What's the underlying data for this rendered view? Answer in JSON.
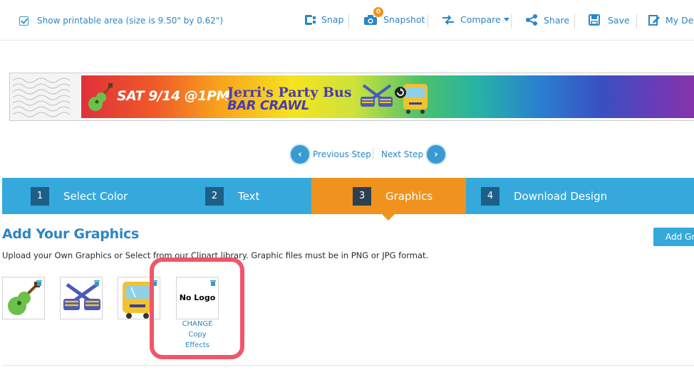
{
  "toolbar": {
    "printable_label": "Show printable area (size is 9.50\" by 0.62\")",
    "snap_label": "Snap",
    "snapshot_label": "Snapshot",
    "snapshot_badge": "0",
    "compare_label": "Compare",
    "share_label": "Share",
    "save_label": "Save",
    "mydesigns_label": "My Des"
  },
  "preview": {
    "date_text": "SAT 9/14 @1PM",
    "line1": "Jerri's Party Bus",
    "line2": "BAR CRAWL"
  },
  "step_nav": {
    "previous_label": "Previous Step",
    "next_label": "Next Step"
  },
  "steps": [
    {
      "num": "1",
      "label": "Select Color"
    },
    {
      "num": "2",
      "label": "Text"
    },
    {
      "num": "3",
      "label": "Graphics",
      "active": true
    },
    {
      "num": "4",
      "label": "Download Design"
    }
  ],
  "graphics": {
    "title": "Add Your Graphics",
    "add_button": "Add Gr",
    "description": "Upload your Own Graphics or Select from our Clipart library. Graphic files must be in PNG or JPG format.",
    "thumbnails": [
      {
        "icon": "guitar-icon"
      },
      {
        "icon": "party-glasses-icon"
      },
      {
        "icon": "bus-icon"
      }
    ],
    "logo_slot": {
      "text": "No Logo",
      "change": "CHANGE",
      "copy": "Copy",
      "effects": "Effects"
    }
  },
  "colors": {
    "accent_blue": "#35a9dc",
    "active_orange": "#f0931e",
    "link_blue": "#2b86c5",
    "highlight_red": "#f0566a"
  }
}
